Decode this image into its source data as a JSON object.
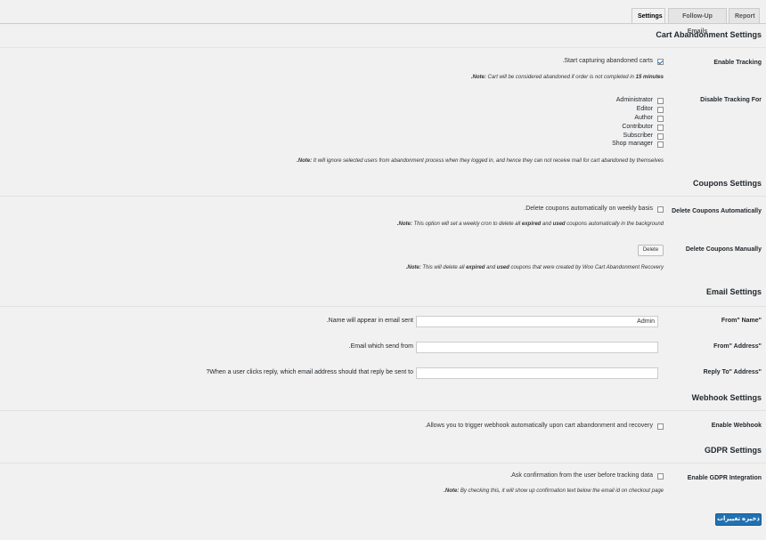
{
  "tabs": [
    {
      "label": "Settings",
      "active": true
    },
    {
      "label": "Follow-Up Emails",
      "active": false
    },
    {
      "label": "Report",
      "active": false
    }
  ],
  "cart_section": {
    "title": "Cart Abandonment Settings",
    "enable_tracking": {
      "label": "Enable Tracking",
      "desc": ".Start capturing abandoned carts",
      "checked": true,
      "note_prefix": ".Note:",
      "note_text": " Cart will be considered abandoned if order is not completed in ",
      "note_strong": "15 minutes"
    },
    "disable_tracking": {
      "label": "Disable Tracking For",
      "roles": [
        "Administrator",
        "Editor",
        "Author",
        "Contributor",
        "Subscriber",
        "Shop manager"
      ],
      "note_prefix": ".Note:",
      "note_text": " It will ignore selected users from abandonment process when they logged in, and hence they can not receive mail for cart abandoned by themselves"
    }
  },
  "coupons_section": {
    "title": "Coupons Settings",
    "auto_delete": {
      "label": "Delete Coupons Automatically",
      "desc": ".Delete coupons automatically on weekly basis",
      "note_prefix": ".Note:",
      "note_a": " This option will set a weekly cron to delete all ",
      "note_b": "expired",
      "note_c": " and ",
      "note_d": "used",
      "note_e": " coupons automatically in the background"
    },
    "manual_delete": {
      "label": "Delete Coupons Manually",
      "button": "Delete",
      "note_prefix": ".Note:",
      "note_a": " This will delete all ",
      "note_b": "expired",
      "note_c": " and ",
      "note_d": "used",
      "note_e": " coupons that were created by Woo Cart Abandonment Recovery"
    }
  },
  "email_section": {
    "title": "Email Settings",
    "from_name": {
      "label": "From\" Name\"",
      "desc": ".Name will appear in email sent",
      "value": "Admin"
    },
    "from_address": {
      "label": "From\" Address\"",
      "desc": ".Email which send from",
      "value": ""
    },
    "reply_to": {
      "label": "Reply To\" Address\"",
      "desc": "?When a user clicks reply, which email address should that reply be sent to",
      "value": ""
    }
  },
  "webhook_section": {
    "title": "Webhook Settings",
    "enable": {
      "label": "Enable Webhook",
      "desc": ".Allows you to trigger webhook automatically upon cart abandonment and recovery"
    }
  },
  "gdpr_section": {
    "title": "GDPR Settings",
    "enable": {
      "label": "Enable GDPR Integration",
      "desc": ".Ask confirmation from the user before tracking data",
      "note_prefix": ".Note:",
      "note_text": " By checking this, it will show up confirmation text below the email id on checkout page"
    }
  },
  "save_button": "ذخیره تغییرات"
}
